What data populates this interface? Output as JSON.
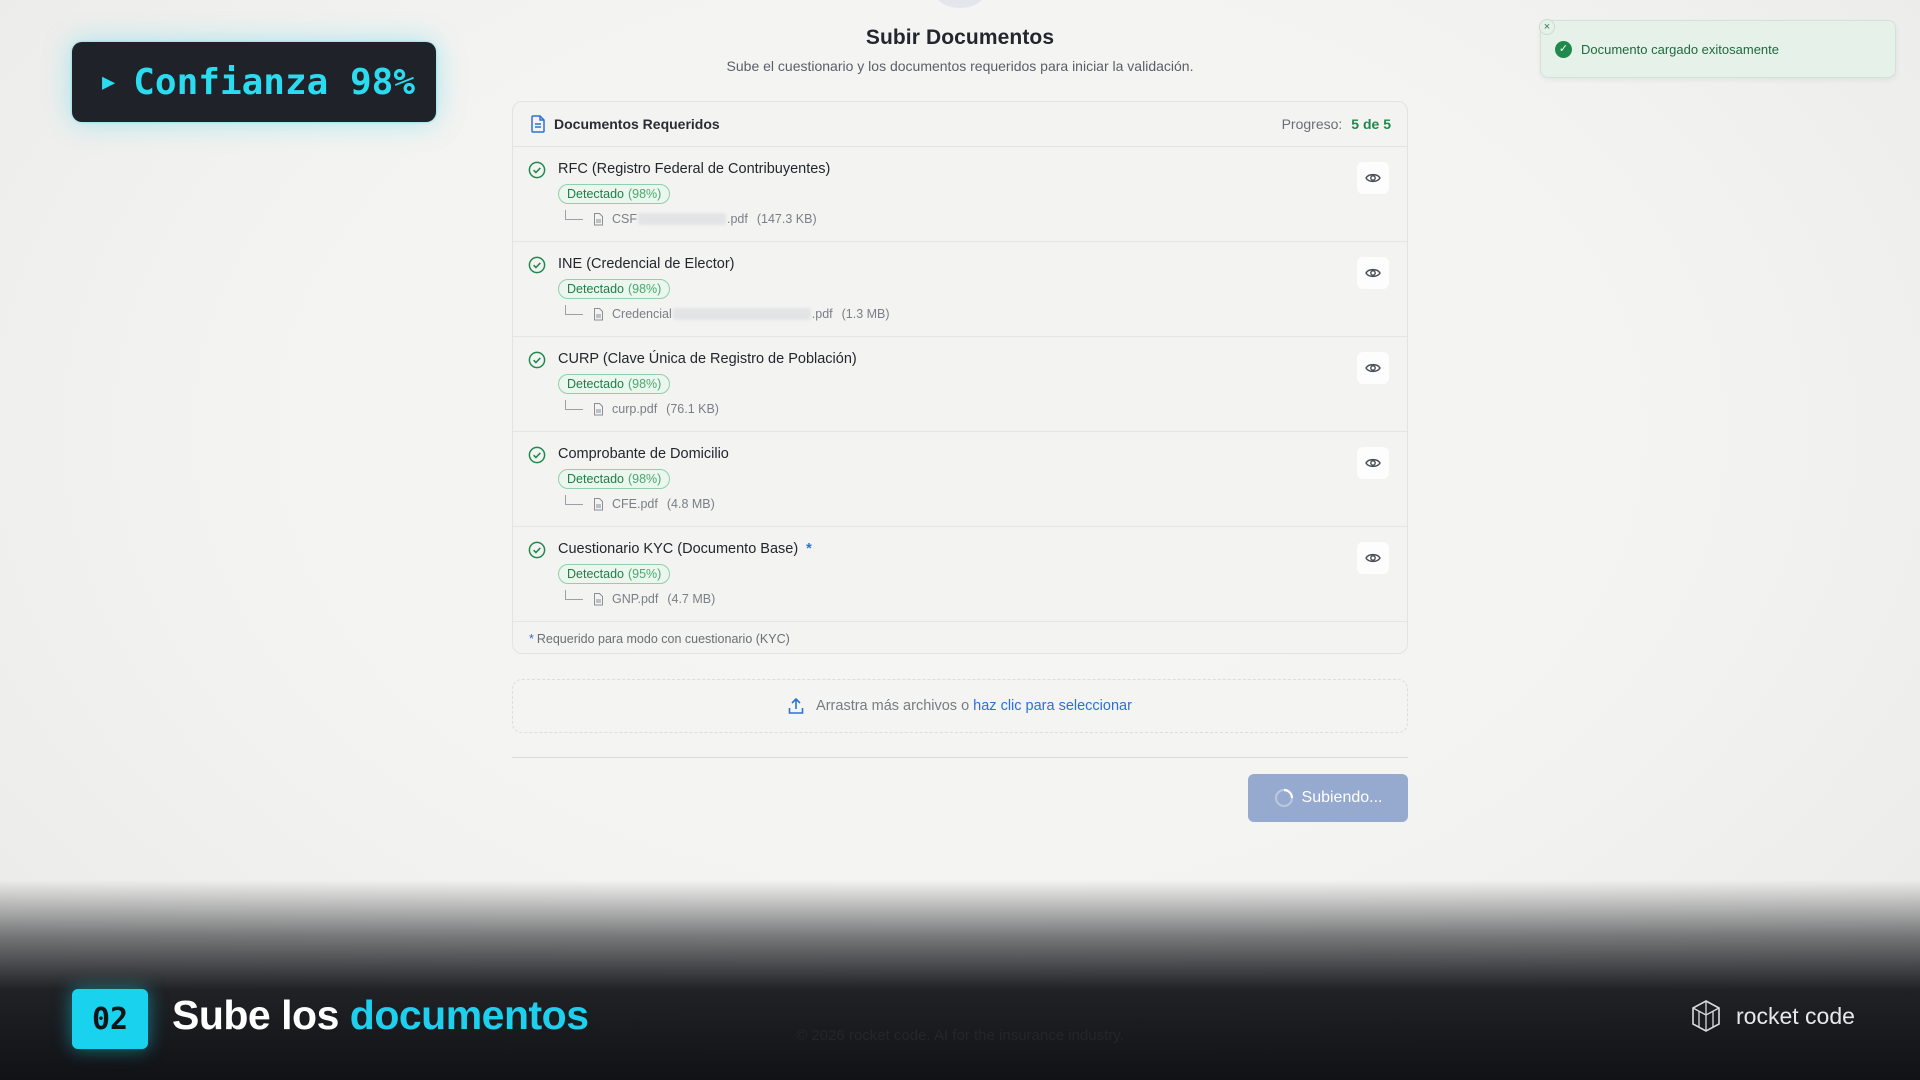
{
  "header": {
    "title": "Subir Documentos",
    "subtitle": "Sube el cuestionario y los documentos requeridos para iniciar la validación."
  },
  "confidence_badge": {
    "label": "Confianza 98%"
  },
  "toast": {
    "message": "Documento cargado exitosamente",
    "close": "×"
  },
  "card": {
    "title": "Documentos Requeridos",
    "progress_label": "Progreso:",
    "progress_value": "5 de 5",
    "documents": [
      {
        "name": "RFC (Registro Federal de Contribuyentes)",
        "status": "Detectado",
        "confidence": "(98%)",
        "file_prefix": "CSF",
        "file_suffix": ".pdf",
        "size": "(147.3 KB)"
      },
      {
        "name": "INE (Credencial de Elector)",
        "status": "Detectado",
        "confidence": "(98%)",
        "file_prefix": "Credencial",
        "file_suffix": ".pdf",
        "size": "(1.3 MB)"
      },
      {
        "name": "CURP (Clave Única de Registro de Población)",
        "status": "Detectado",
        "confidence": "(98%)",
        "file_prefix": "curp.pdf",
        "file_suffix": "",
        "size": "(76.1 KB)"
      },
      {
        "name": "Comprobante de Domicilio",
        "status": "Detectado",
        "confidence": "(98%)",
        "file_prefix": "CFE.pdf",
        "file_suffix": "",
        "size": "(4.8 MB)"
      },
      {
        "name": "Cuestionario KYC (Documento Base)",
        "required_marker": "*",
        "status": "Detectado",
        "confidence": "(95%)",
        "file_prefix": "GNP.pdf",
        "file_suffix": "",
        "size": "(4.7 MB)"
      }
    ],
    "footnote_star": "*",
    "footnote": "Requerido para modo con cuestionario (KYC)"
  },
  "dropzone": {
    "text": "Arrastra más archivos o",
    "link": "haz clic para seleccionar"
  },
  "submit": {
    "label": "Subiendo..."
  },
  "banner": {
    "step": "02",
    "title_plain": "Sube los",
    "title_highlight": "documentos",
    "brand": "rocket code",
    "footer": "© 2026 rocket code. AI for the insurance industry."
  },
  "colors": {
    "accent": "#19d3ee",
    "success": "#1f8a4c",
    "link": "#2b72d6",
    "button_disabled": "#96a9cf"
  }
}
